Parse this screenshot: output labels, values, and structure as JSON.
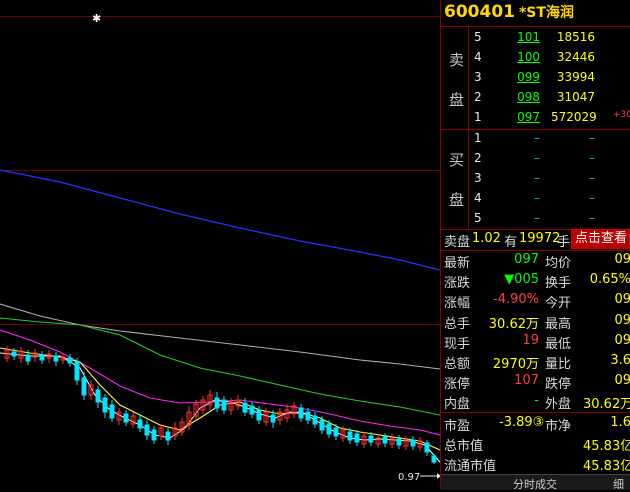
{
  "stock": {
    "code": "600401",
    "name": "*ST海润"
  },
  "sell_side_label_1": "卖",
  "sell_side_label_2": "盘",
  "buy_side_label_1": "买",
  "buy_side_label_2": "盘",
  "sell_orders": [
    {
      "level": "5",
      "price": "101",
      "volume": "18516",
      "change": ""
    },
    {
      "level": "4",
      "price": "100",
      "volume": "32446",
      "change": ""
    },
    {
      "level": "3",
      "price": "099",
      "volume": "33994",
      "change": ""
    },
    {
      "level": "2",
      "price": "098",
      "volume": "31047",
      "change": ""
    },
    {
      "level": "1",
      "price": "097",
      "volume": "572029",
      "change": "+30"
    }
  ],
  "buy_orders": [
    {
      "level": "1",
      "price": "–",
      "volume": "–"
    },
    {
      "level": "2",
      "price": "–",
      "volume": "–"
    },
    {
      "level": "3",
      "price": "–",
      "volume": "–"
    },
    {
      "level": "4",
      "price": "–",
      "volume": "–"
    },
    {
      "level": "5",
      "price": "–",
      "volume": "–"
    }
  ],
  "sell_summary": {
    "text_1": "卖盘",
    "ratio": "1.02",
    "text_2": "有",
    "volume": "19972",
    "text_3": "手",
    "button": "点击查看"
  },
  "stats": [
    {
      "l1": "最新",
      "v1": "097",
      "l2": "均价",
      "v2": "09"
    },
    {
      "l1": "涨跌",
      "v1": "▼005",
      "l2": "换手",
      "v2": "0.65%"
    },
    {
      "l1": "涨幅",
      "v1": "-4.90%",
      "l2": "今开",
      "v2": "09"
    },
    {
      "l1": "总手",
      "v1": "30.62万",
      "l2": "最高",
      "v2": "09"
    },
    {
      "l1": "现手",
      "v1": "19",
      "l2": "最低",
      "v2": "09"
    },
    {
      "l1": "总额",
      "v1": "2970万",
      "l2": "量比",
      "v2": "3.6"
    },
    {
      "l1": "涨停",
      "v1": "107",
      "l2": "跌停",
      "v2": "09"
    },
    {
      "l1": "内盘",
      "v1": "-",
      "l2": "外盘",
      "v2": "30.62万"
    }
  ],
  "valuation": [
    {
      "l1": "市盈",
      "v1": "-3.89③",
      "l2": "市净",
      "v2": "1.6"
    },
    {
      "l1": "总市值",
      "v1": "",
      "l2": "",
      "v2": "45.83亿"
    },
    {
      "l1": "流通市值",
      "v1": "",
      "l2": "",
      "v2": "45.83亿"
    }
  ],
  "tabs": {
    "t1": "分时成交",
    "t2": "细"
  },
  "chart_data": {
    "type": "line",
    "price_label": "0.97",
    "colors": {
      "ma_blue": "#2233ff",
      "ma_gray": "#b0b0b0",
      "ma_green": "#22cc22",
      "ma_magenta": "#ff22ff",
      "ma_yellow": "#ffff33",
      "ma_white": "#ffffff",
      "candle_up": "#ff3030",
      "candle_down": "#00e5ff"
    }
  }
}
